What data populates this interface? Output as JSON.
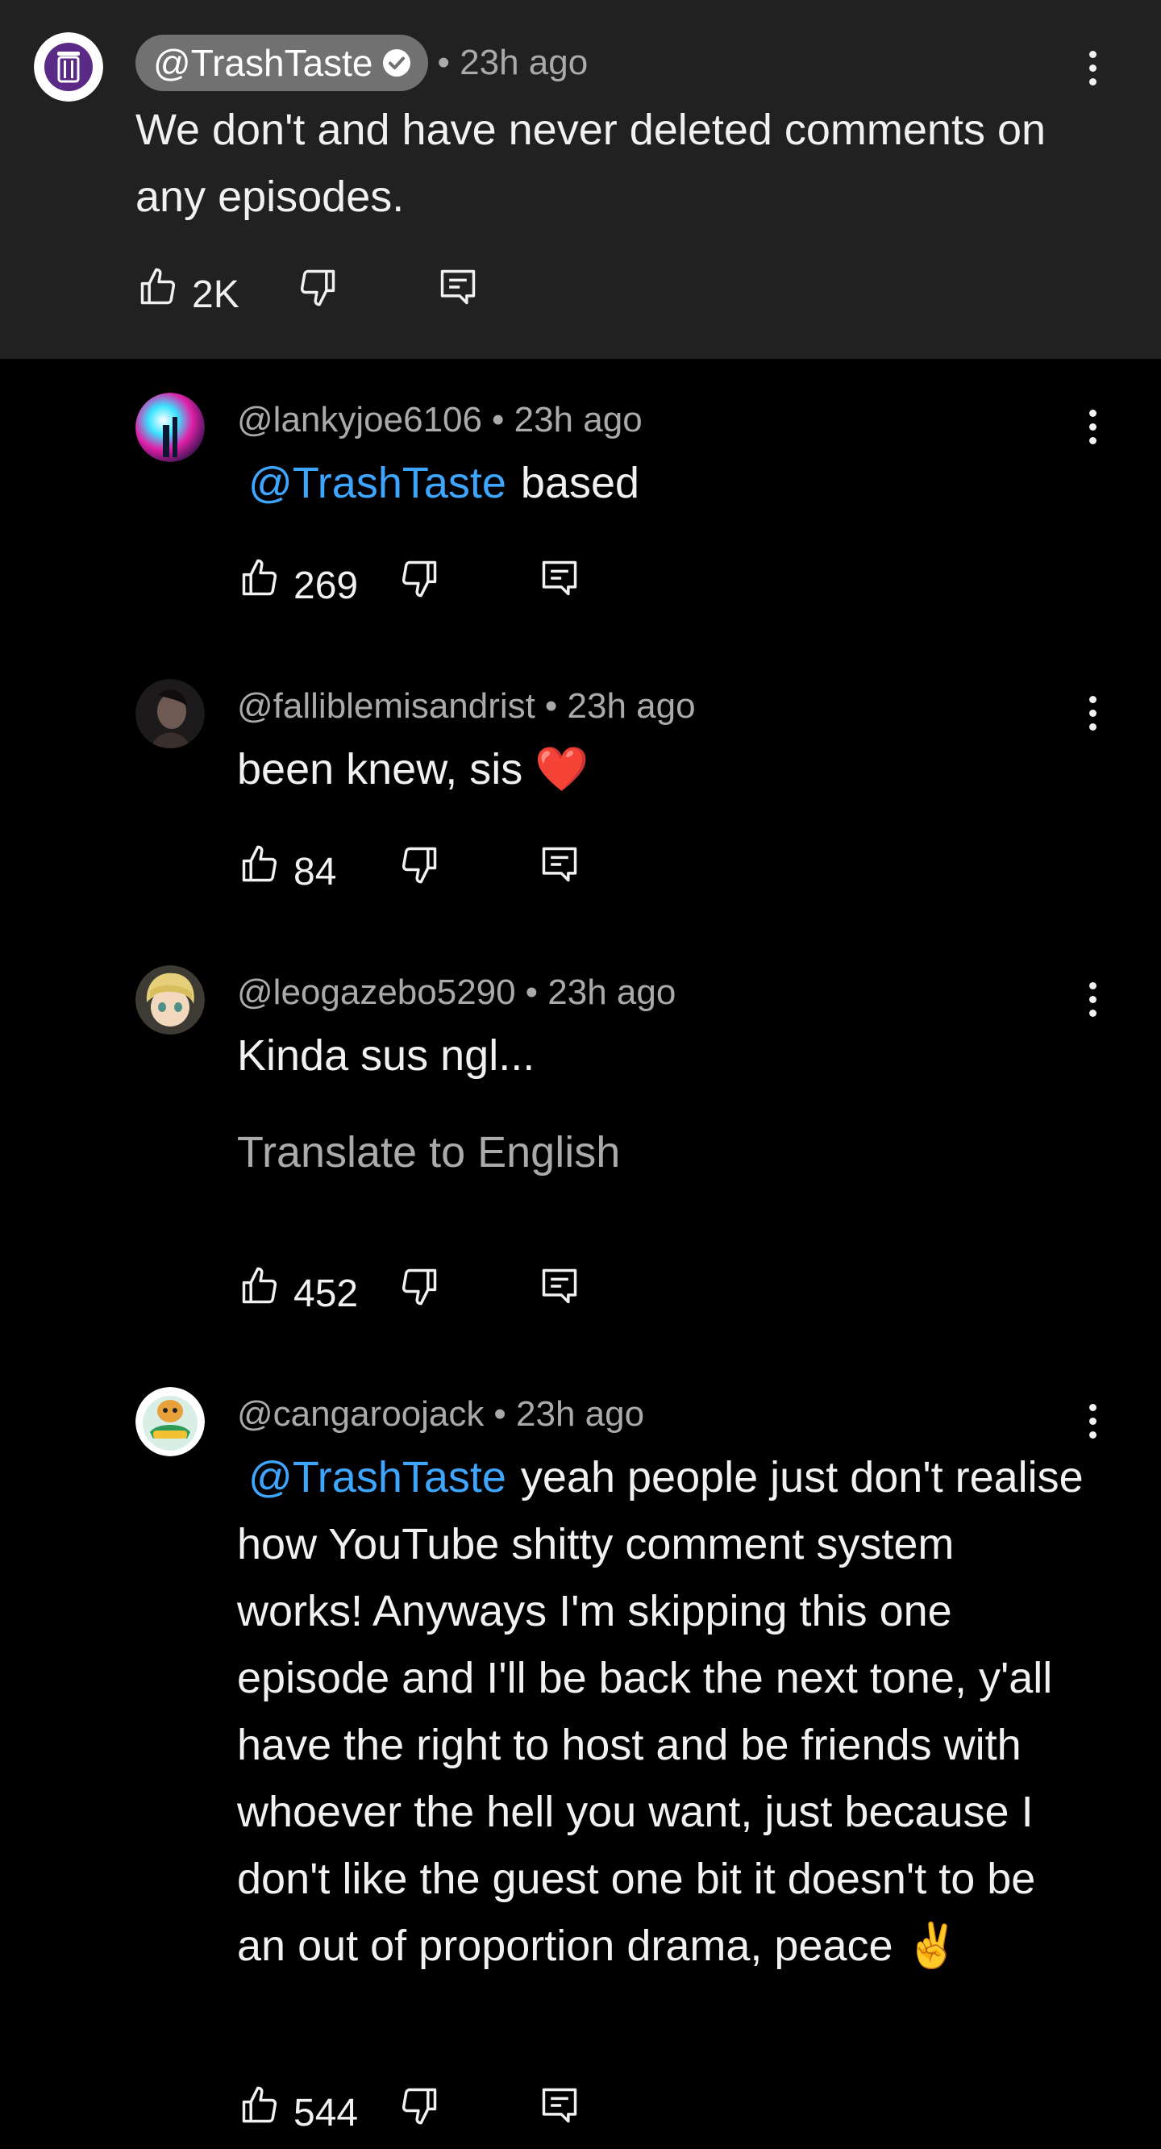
{
  "pinned": {
    "channel": "@TrashTaste",
    "time": "• 23h ago",
    "text": "We don't and have never deleted comments on any episodes.",
    "likes": "2K"
  },
  "replies": [
    {
      "author": "@lankyjoe6106",
      "time": "• 23h ago",
      "mention": "@TrashTaste",
      "text": "based",
      "likes": "269"
    },
    {
      "author": "@falliblemisandrist",
      "time": "• 23h ago",
      "text": "been knew, sis ❤️",
      "likes": "84"
    },
    {
      "author": "@leogazebo5290",
      "time": "• 23h ago",
      "text": "Kinda sus ngl...",
      "translate": "Translate to English",
      "likes": "452"
    },
    {
      "author": "@cangaroojack",
      "time": "• 23h ago",
      "mention": "@TrashTaste",
      "text": "yeah people just don't realise how YouTube shitty comment system works! Anyways I'm skipping this one episode and I'll be back the next tone, y'all have the right to host and be friends with whoever the hell you want, just because I don't like the guest one bit it doesn't to be an out of proportion drama, peace ✌️",
      "likes": "544"
    }
  ],
  "colors": {
    "background": "#000000",
    "pinned_background": "#212121",
    "mention": "#3ea6ff",
    "secondary_text": "#aaaaaa",
    "owner_chip": "#717171"
  },
  "icons": [
    "trash-taste-logo",
    "verified-check-icon",
    "thumb-up-icon",
    "thumb-down-icon",
    "reply-icon",
    "more-vert-icon"
  ]
}
